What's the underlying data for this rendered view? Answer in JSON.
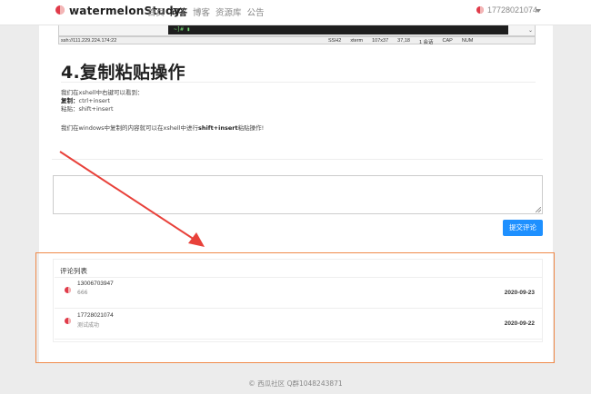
{
  "navbar": {
    "brand": "watermelonStudy",
    "items": [
      {
        "label": "首页",
        "active": false
      },
      {
        "label": "问答",
        "active": true
      },
      {
        "label": "博客",
        "active": false
      },
      {
        "label": "资源库",
        "active": false
      },
      {
        "label": "公告",
        "active": false
      }
    ],
    "user": "17728021074"
  },
  "terminal": {
    "prompt_fragment": "~]# ▮",
    "address": "ssh://111.229.224.174:22",
    "status_fields": [
      "SSH2",
      "xterm",
      "107x37",
      "37,18",
      "1 会话",
      "CAP",
      "NUM"
    ]
  },
  "article": {
    "heading": "4.复制粘贴操作",
    "line1": "我们在xshell中右键可以看到：",
    "copy_label": "复制：",
    "copy_keys": "ctrl+insert",
    "paste_label": "粘贴：",
    "paste_keys": "shift+insert",
    "tip_prefix": "我们在windows中复制的内容就可以在xshell中进行",
    "tip_bold": "shift+insert",
    "tip_suffix": "粘贴操作!"
  },
  "comment_form": {
    "placeholder": "",
    "submit_label": "提交评论"
  },
  "comments": {
    "title": "评论列表",
    "items": [
      {
        "user": "13006703947",
        "text": "666",
        "date": "2020-09-23"
      },
      {
        "user": "17728021074",
        "text": "测试成功",
        "date": "2020-09-22"
      }
    ]
  },
  "footer": {
    "text": "© 西瓜社区 Q群1048243871"
  },
  "colors": {
    "accent": "#1e90ff",
    "highlight": "#f08a4a",
    "arrow": "#e8413a",
    "brand_red": "#e03b4a"
  },
  "icons": [
    "watermelon-logo-icon",
    "caret-down-icon",
    "resize-grip-icon",
    "arrow-annotation-icon"
  ]
}
